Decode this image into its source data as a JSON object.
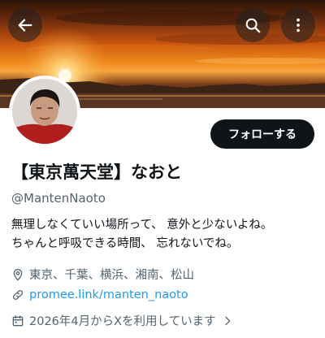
{
  "header": {
    "back_icon": "arrow-left-icon",
    "search_icon": "search-icon",
    "more_icon": "more-vertical-icon"
  },
  "profile": {
    "follow_label": "フォローする",
    "display_name": "【東京萬天堂】なおと",
    "handle": "@MantenNaoto",
    "bio_line1": "無理しなくていい場所って、 意外と少ないよね。",
    "bio_line2": "ちゃんと呼吸できる時間、 忘れないでね。",
    "location": "東京、千葉、横浜、湘南、松山",
    "website": "promee.link/manten_naoto",
    "joined": "2026年4月からXを利用しています"
  },
  "colors": {
    "accent": "#1d9bf0",
    "button_bg": "#0f1419",
    "secondary_text": "#536471"
  }
}
